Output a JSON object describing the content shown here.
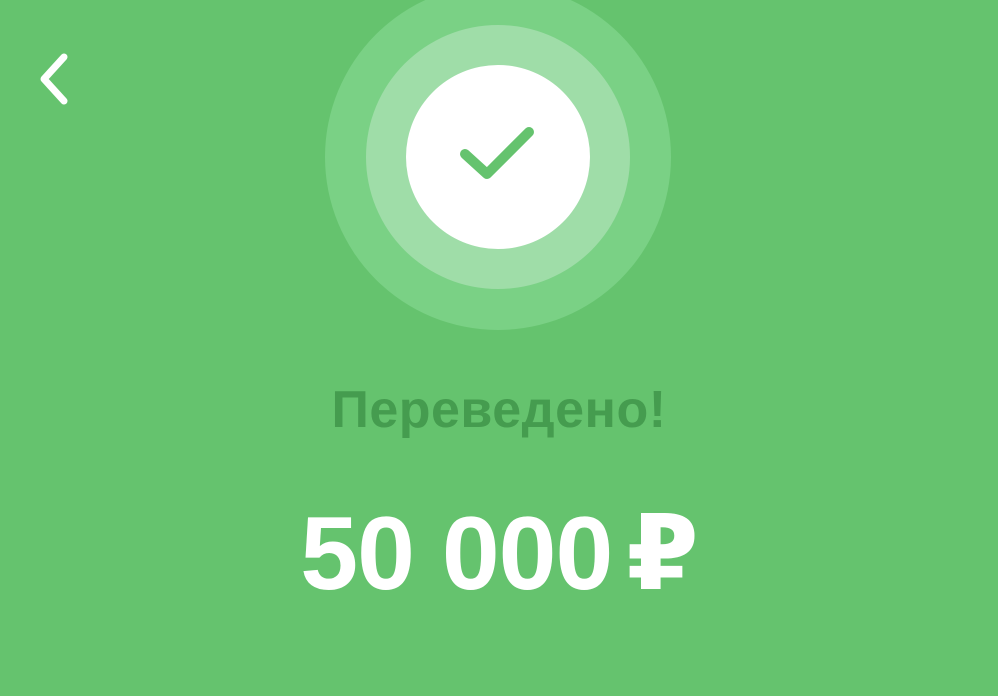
{
  "screen": {
    "back_icon": "chevron-left-icon",
    "status_icon": "check-icon",
    "status_title": "Переведено!",
    "amount_value": "50 000",
    "currency_symbol": "₽"
  },
  "colors": {
    "background": "#65c36e",
    "ring_outer": "#7ad185",
    "ring_middle": "#9fdda8",
    "ring_inner": "#ffffff",
    "check": "#65c36e",
    "title": "#459c4f",
    "amount": "#ffffff"
  }
}
